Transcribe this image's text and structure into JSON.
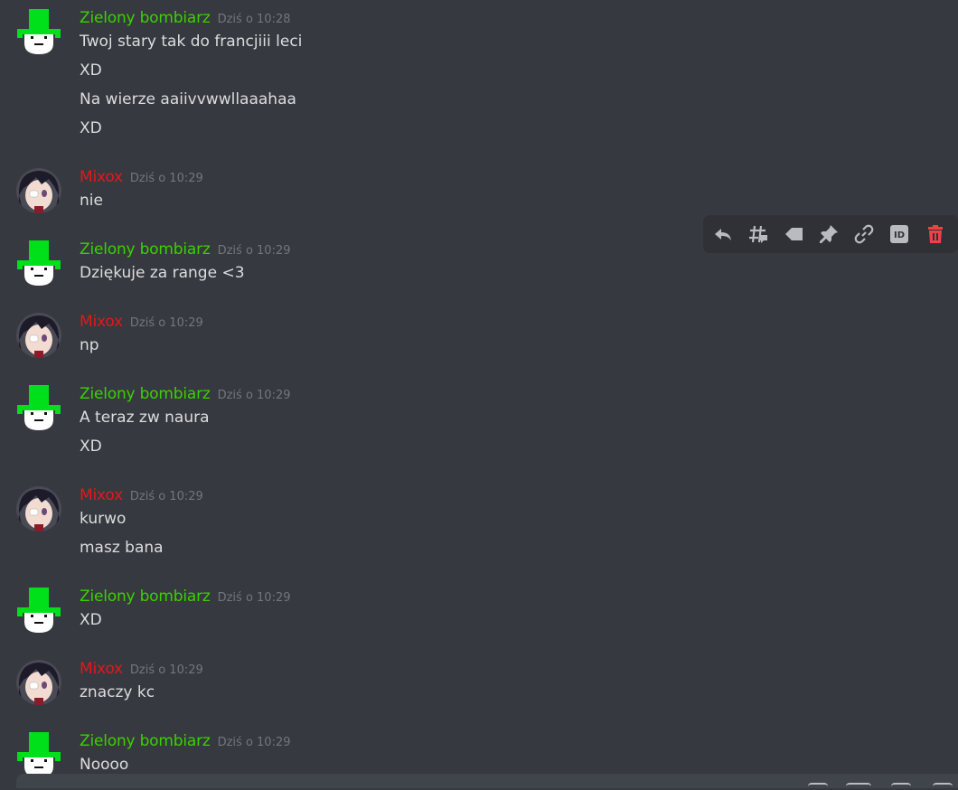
{
  "messages": [
    {
      "author": "Zielony bombiarz",
      "color": "green",
      "time": "Dziś o 10:28",
      "lines": [
        "Twoj stary tak do francjiii leci",
        "XD",
        "Na wierze aaiivvwwllaaahaa",
        "XD"
      ]
    },
    {
      "author": "Mixox",
      "color": "red",
      "time": "Dziś o 10:29",
      "lines": [
        "nie"
      ]
    },
    {
      "author": "Zielony bombiarz",
      "color": "green",
      "time": "Dziś o 10:29",
      "lines": [
        "Dziękuje za range <3"
      ]
    },
    {
      "author": "Mixox",
      "color": "red",
      "time": "Dziś o 10:29",
      "lines": [
        "np"
      ]
    },
    {
      "author": "Zielony bombiarz",
      "color": "green",
      "time": "Dziś o 10:29",
      "lines": [
        "A teraz zw naura",
        "XD"
      ]
    },
    {
      "author": "Mixox",
      "color": "red",
      "time": "Dziś o 10:29",
      "lines": [
        "kurwo",
        "masz bana"
      ]
    },
    {
      "author": "Zielony bombiarz",
      "color": "green",
      "time": "Dziś o 10:29",
      "lines": [
        "XD"
      ]
    },
    {
      "author": "Mixox",
      "color": "red",
      "time": "Dziś o 10:29",
      "lines": [
        "znaczy kc"
      ]
    },
    {
      "author": "Zielony bombiarz",
      "color": "green",
      "time": "Dziś o 10:29",
      "lines": [
        "Noooo"
      ]
    }
  ],
  "toolbar": {
    "icons": [
      "reply-icon",
      "create-thread-icon",
      "tag-icon",
      "pin-icon",
      "copy-link-icon",
      "copy-id-icon",
      "delete-icon"
    ],
    "id_label": "ID"
  },
  "colors": {
    "background": "#36393f",
    "green_name": "#3bd100",
    "red_name": "#e0191c",
    "delete": "#ed4245"
  }
}
